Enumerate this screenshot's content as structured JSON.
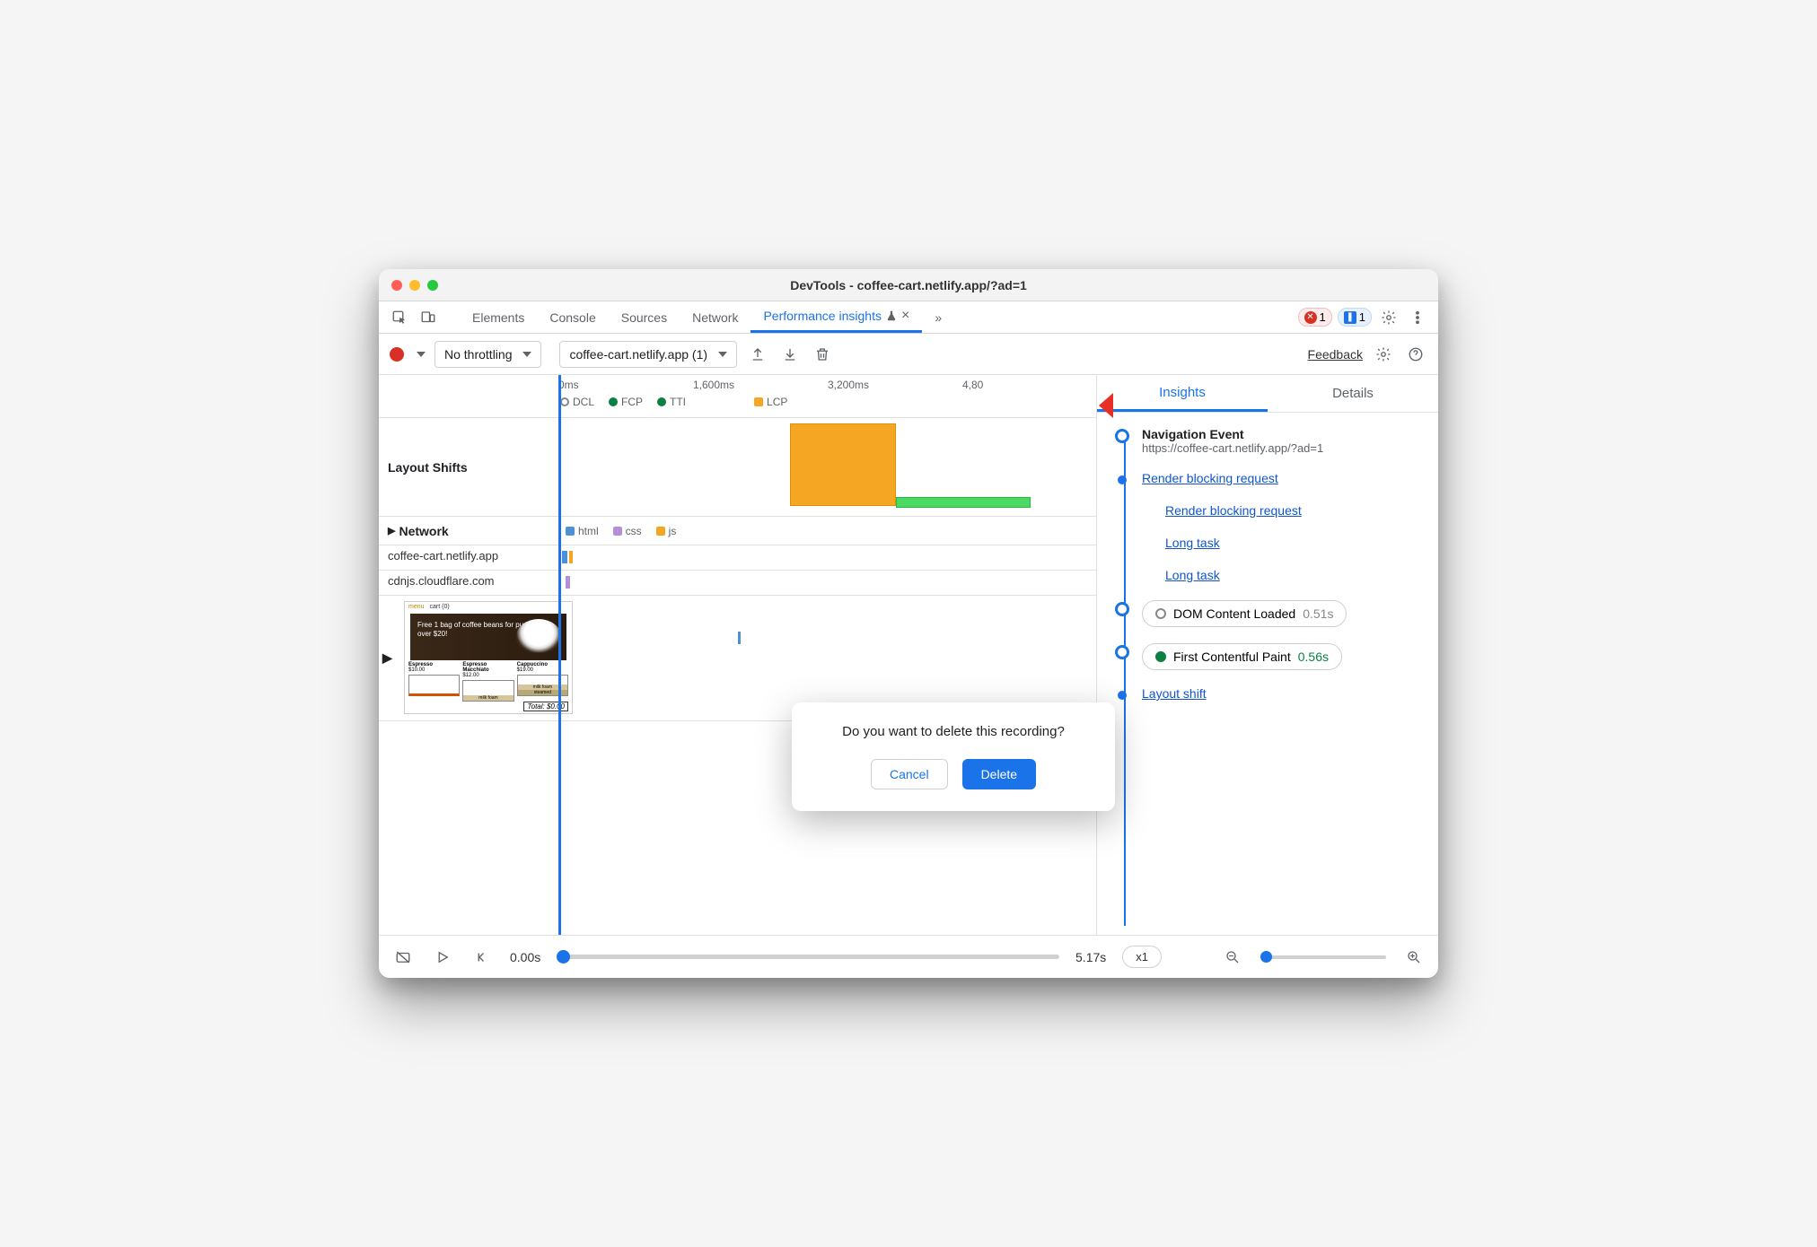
{
  "window": {
    "title": "DevTools - coffee-cart.netlify.app/?ad=1"
  },
  "tabs": {
    "elements": "Elements",
    "console": "Console",
    "sources": "Sources",
    "network": "Network",
    "perf_insights": "Performance insights"
  },
  "badges": {
    "errors": "1",
    "info": "1"
  },
  "toolbar": {
    "throttling": "No throttling",
    "recording_name": "coffee-cart.netlify.app (1)",
    "feedback": "Feedback"
  },
  "ruler": {
    "t0": "0ms",
    "t1": "1,600ms",
    "t2": "3,200ms",
    "t3": "4,80"
  },
  "markers": {
    "dcl": "DCL",
    "fcp": "FCP",
    "tti": "TTI",
    "lcp": "LCP"
  },
  "rows": {
    "layout_shifts": "Layout Shifts",
    "network": "Network",
    "net_hosts": [
      "coffee-cart.netlify.app",
      "cdnjs.cloudflare.com"
    ]
  },
  "legend": {
    "html": "html",
    "css": "css",
    "js": "js"
  },
  "frames_promo": "Free 1 bag of coffee beans for purchase over $20!",
  "frames_total": "Total: $0.00",
  "frames_items": {
    "espresso": "Espresso",
    "espresso_p": "$10.00",
    "macchiato": "Espresso Macchiato",
    "macchiato_p": "$12.00",
    "cappuccino": "Cappuccino",
    "cappuccino_p": "$19.00",
    "milk_foam": "milk foam",
    "steamed": "steamed",
    "menu": "menu",
    "cart": "cart (0)"
  },
  "insights_tabs": {
    "insights": "Insights",
    "details": "Details"
  },
  "insights": {
    "nav_title": "Navigation Event",
    "nav_url": "https://coffee-cart.netlify.app/?ad=1",
    "render_blocking": "Render blocking request",
    "long_task": "Long task",
    "dcl_label": "DOM Content Loaded",
    "dcl_time": "0.51s",
    "fcp_label": "First Contentful Paint",
    "fcp_time": "0.56s",
    "layout_shift": "Layout shift"
  },
  "playbar": {
    "start": "0.00s",
    "end": "5.17s",
    "speed": "x1"
  },
  "modal": {
    "text": "Do you want to delete this recording?",
    "cancel": "Cancel",
    "delete": "Delete"
  }
}
